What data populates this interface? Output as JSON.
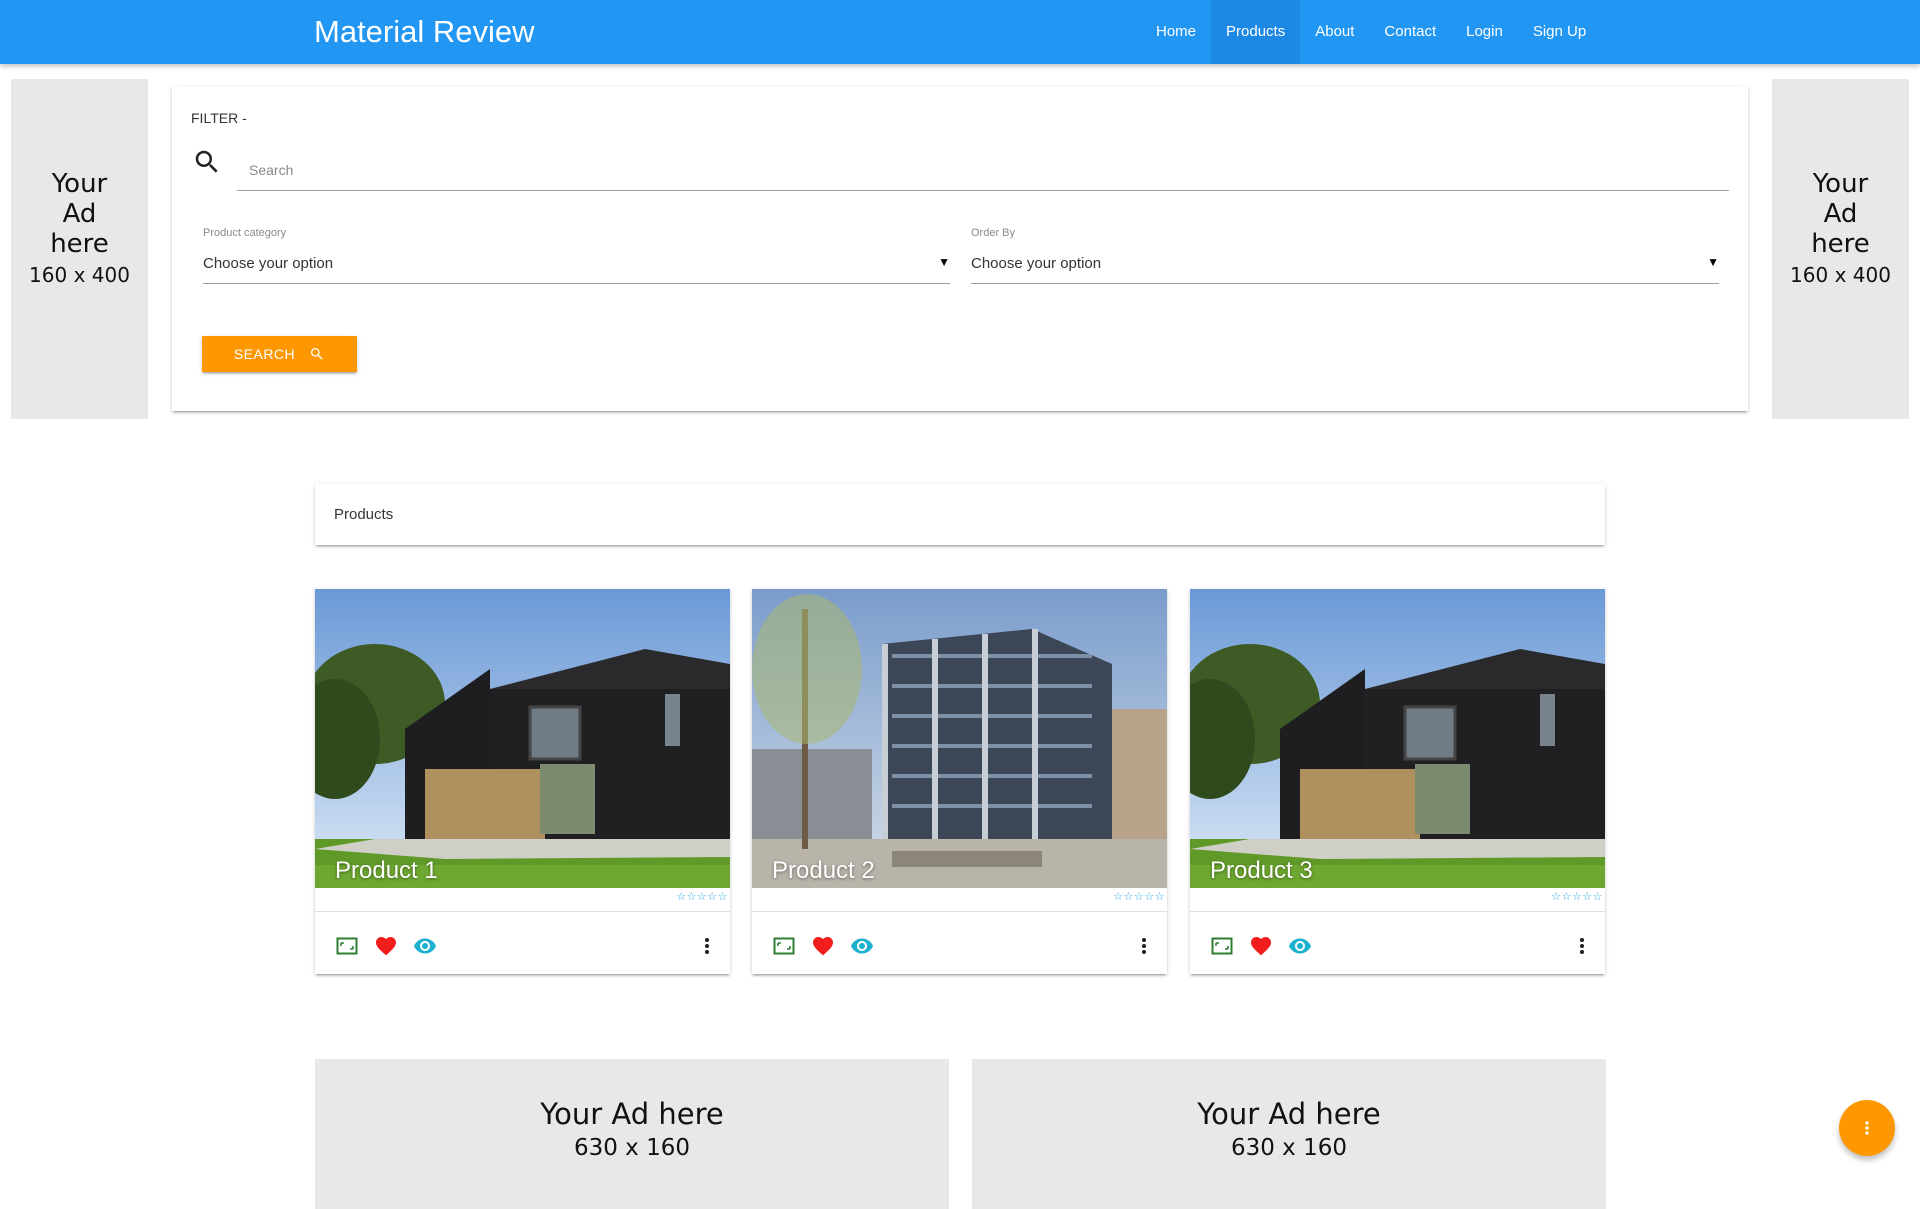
{
  "navbar": {
    "brand": "Material Review",
    "items": [
      {
        "label": "Home",
        "active": false
      },
      {
        "label": "Products",
        "active": true
      },
      {
        "label": "About",
        "active": false
      },
      {
        "label": "Contact",
        "active": false
      },
      {
        "label": "Login",
        "active": false
      },
      {
        "label": "Sign Up",
        "active": false
      }
    ]
  },
  "side_ads": {
    "left": {
      "text": "Your Ad here",
      "size": "160 x 400"
    },
    "right": {
      "text": "Your Ad here",
      "size": "160 x 400"
    }
  },
  "filter": {
    "title": "FILTER -",
    "search_placeholder": "Search",
    "category": {
      "label": "Product category",
      "value": "Choose your option"
    },
    "order_by": {
      "label": "Order By",
      "value": "Choose your option"
    },
    "button_label": "SEARCH"
  },
  "products_header": "Products",
  "products": [
    {
      "title": "Product 1",
      "rating": "☆☆☆☆☆",
      "stars_filled": 0
    },
    {
      "title": "Product 2",
      "rating": "☆☆☆☆☆",
      "stars_filled": 0
    },
    {
      "title": "Product 3",
      "rating": "☆☆☆☆☆",
      "stars_filled": 0
    }
  ],
  "bottom_ads": [
    {
      "text": "Your Ad here",
      "size": "630 x 160"
    },
    {
      "text": "Your Ad here",
      "size": "630 x 160"
    }
  ],
  "colors": {
    "primary": "#2196f3",
    "primary_active": "#1e88e5",
    "accent": "#ff9800",
    "heart": "#f21d1d",
    "eye": "#1eb1cf",
    "compare": "#2e7d32",
    "stars": "#29a3e6"
  },
  "icons": {
    "search": "search-icon",
    "card_actions": [
      "compare-icon",
      "heart-icon",
      "eye-icon",
      "more-vert-icon"
    ],
    "fab": "more-vert-icon"
  }
}
